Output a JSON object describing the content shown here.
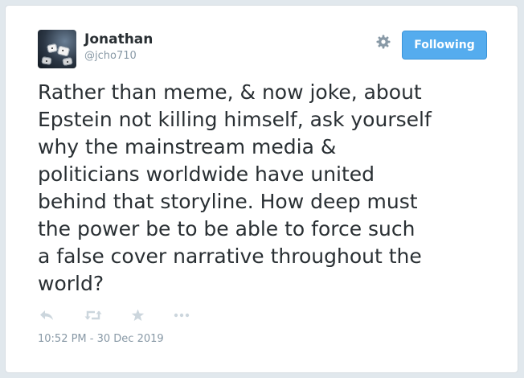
{
  "author": {
    "name": "Jonathan",
    "handle": "@jcho710"
  },
  "follow_button": {
    "label": "Following"
  },
  "tweet": {
    "text": "Rather than meme, & now joke, about\nEpstein not killing himself, ask yourself\nwhy the mainstream media &\npoliticians worldwide have united\nbehind that storyline. How deep must\nthe power be to be able to force such\na false cover narrative throughout the\nworld?",
    "timestamp": "10:52 PM - 30 Dec 2019"
  },
  "icons": {
    "avatar": "profile-photo",
    "settings": "gear-icon",
    "reply": "reply-icon",
    "retweet": "retweet-icon",
    "like": "star-icon",
    "more": "more-icon"
  },
  "colors": {
    "accent": "#55acee",
    "text": "#292f33",
    "muted": "#8899a6",
    "action_icon": "#ccd6dd"
  }
}
